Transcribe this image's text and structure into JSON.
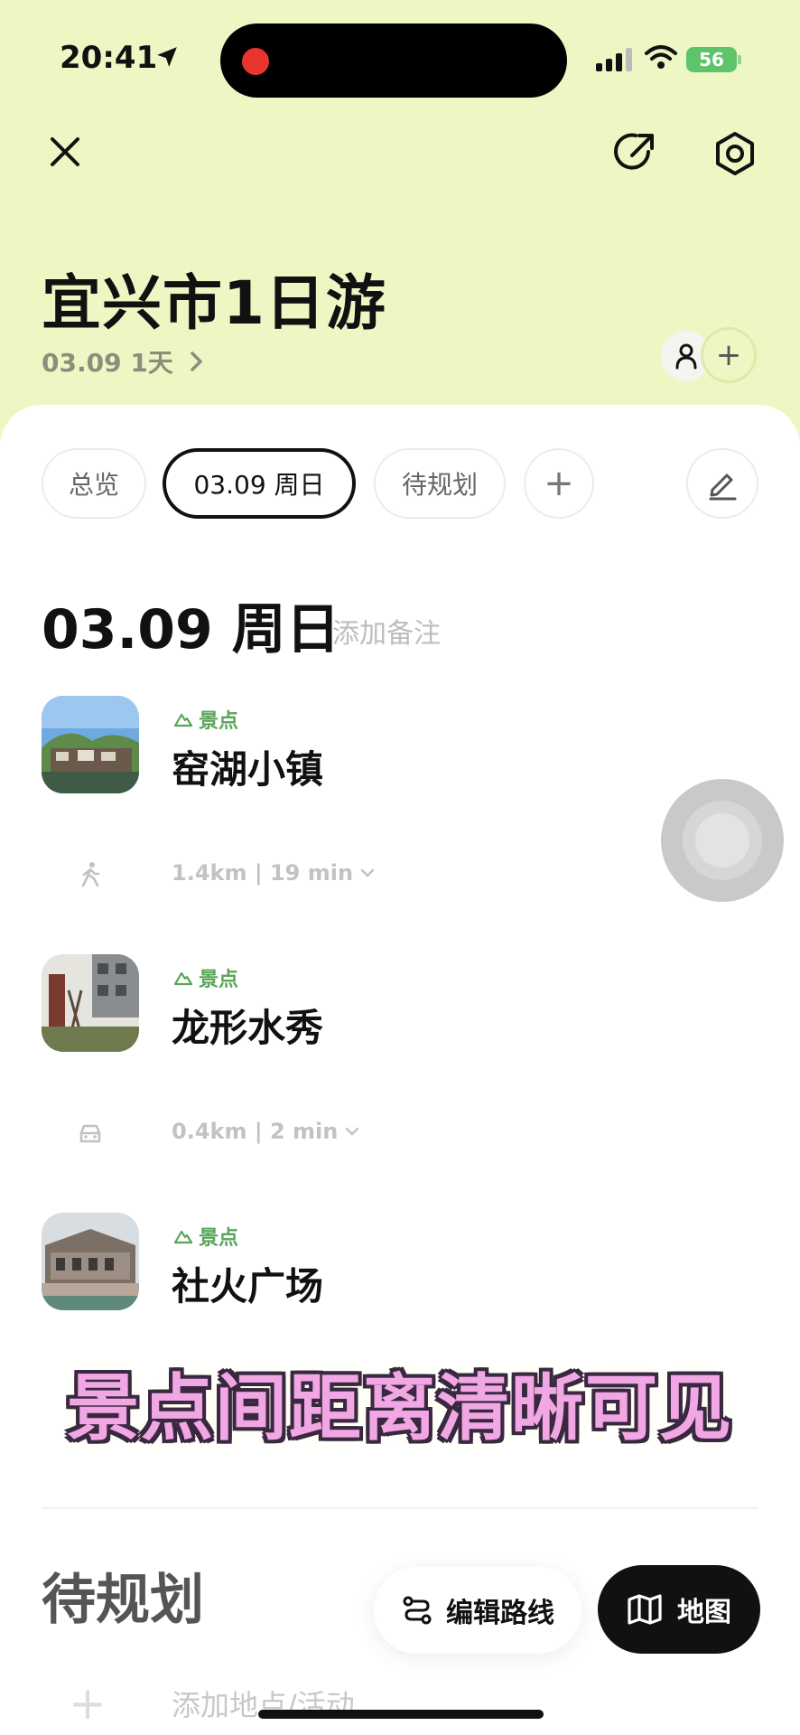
{
  "status_bar": {
    "time": "20:41",
    "battery": "56"
  },
  "header": {
    "title": "宜兴市1日游",
    "subtitle": "03.09 1天",
    "add_member_symbol": "+"
  },
  "tabs": [
    {
      "label": "总览",
      "active": false
    },
    {
      "label": "03.09 周日",
      "active": true
    },
    {
      "label": "待规划",
      "active": false
    },
    {
      "label": "+",
      "active": false
    }
  ],
  "day": {
    "title": "03.09 周日",
    "note_placeholder": "添加备注"
  },
  "places": [
    {
      "tag": "景点",
      "name": "窑湖小镇"
    },
    {
      "tag": "景点",
      "name": "龙形水秀"
    },
    {
      "tag": "景点",
      "name": "社火广场"
    }
  ],
  "transits": [
    {
      "mode": "walk",
      "text": "1.4km | 19 min"
    },
    {
      "mode": "car",
      "text": "0.4km | 2 min"
    }
  ],
  "caption": "景点间距离清晰可见",
  "pending": {
    "title": "待规划",
    "add_text": "添加地点/活动",
    "add_symbol": "+"
  },
  "actions": {
    "edit_route": "编辑路线",
    "map": "地图"
  },
  "colors": {
    "header_bg": "#eef6c4",
    "tag_green": "#5aa55a",
    "recording_red": "#e8352d",
    "caption_pink": "#f1a7e4"
  }
}
